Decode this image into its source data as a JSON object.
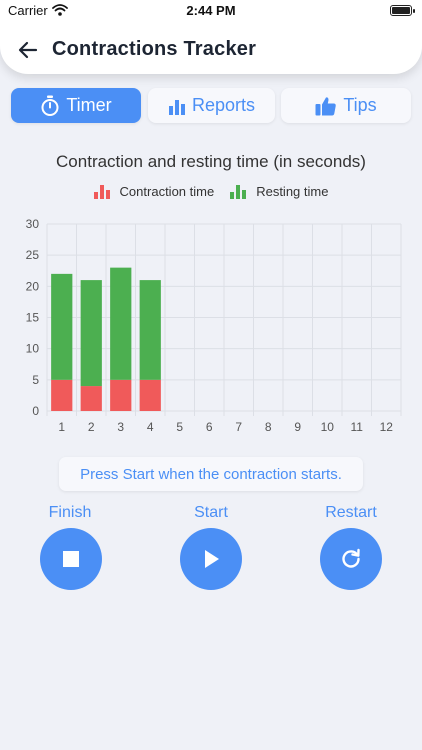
{
  "status_bar": {
    "carrier": "Carrier",
    "time": "2:44 PM"
  },
  "header": {
    "title": "Contractions Tracker",
    "back_icon": "arrow-left-icon"
  },
  "tabs": [
    {
      "label": "Timer",
      "icon": "stopwatch-icon",
      "active": true
    },
    {
      "label": "Reports",
      "icon": "bar-chart-icon",
      "active": false
    },
    {
      "label": "Tips",
      "icon": "thumbs-up-icon",
      "active": false
    }
  ],
  "colors": {
    "accent": "#4b8ff5",
    "contraction": "#f05a5a",
    "resting": "#4caf50"
  },
  "chart_data": {
    "type": "bar",
    "stacked": true,
    "title": "Contraction and resting time (in seconds)",
    "categories": [
      "1",
      "2",
      "3",
      "4",
      "5",
      "6",
      "7",
      "8",
      "9",
      "10",
      "11",
      "12"
    ],
    "series": [
      {
        "name": "Contraction time",
        "values": [
          5,
          4,
          5,
          5,
          0,
          0,
          0,
          0,
          0,
          0,
          0,
          0
        ]
      },
      {
        "name": "Resting time",
        "values": [
          17,
          17,
          18,
          16,
          0,
          0,
          0,
          0,
          0,
          0,
          0,
          0
        ]
      }
    ],
    "ylim": [
      0,
      30
    ],
    "yticks": [
      0,
      5,
      10,
      15,
      20,
      25,
      30
    ],
    "grid": true,
    "legend_position": "top"
  },
  "hint": "Press Start when the contraction starts.",
  "controls": [
    {
      "label": "Finish",
      "icon": "stop-icon"
    },
    {
      "label": "Start",
      "icon": "play-icon"
    },
    {
      "label": "Restart",
      "icon": "refresh-icon"
    }
  ]
}
